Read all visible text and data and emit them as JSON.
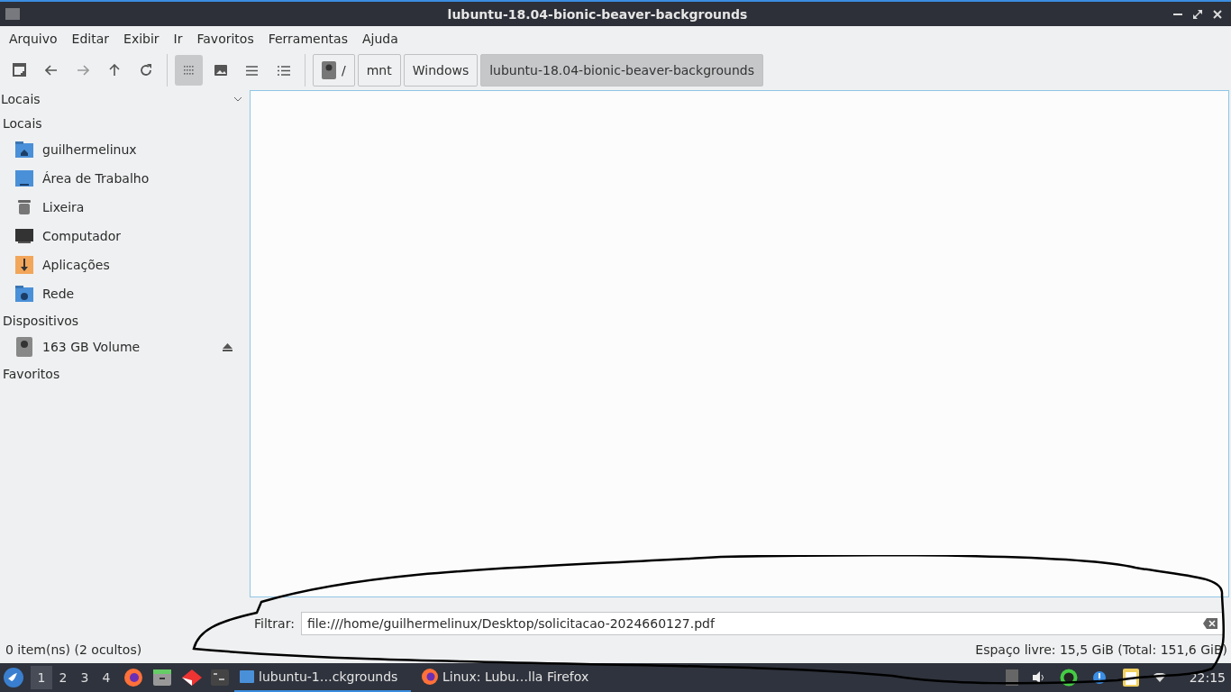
{
  "window": {
    "title": "lubuntu-18.04-bionic-beaver-backgrounds"
  },
  "menu": [
    "Arquivo",
    "Editar",
    "Exibir",
    "Ir",
    "Favoritos",
    "Ferramentas",
    "Ajuda"
  ],
  "toolbar": {
    "view_modes": [
      {
        "kind": "icons",
        "selected": true
      },
      {
        "kind": "thumbnails",
        "selected": false
      },
      {
        "kind": "compact",
        "selected": false
      },
      {
        "kind": "detailed",
        "selected": false
      }
    ]
  },
  "path": [
    {
      "label": "/",
      "kind": "drive",
      "selected": false
    },
    {
      "label": "mnt",
      "kind": "plain",
      "selected": false
    },
    {
      "label": "Windows",
      "kind": "plain",
      "selected": false
    },
    {
      "label": "lubuntu-18.04-bionic-beaver-backgrounds",
      "kind": "plain",
      "selected": true
    }
  ],
  "sidebar": {
    "header": "Locais",
    "sections": [
      {
        "title": "Locais",
        "items": [
          {
            "label": "guilhermelinux",
            "kind": "home"
          },
          {
            "label": "Área de Trabalho",
            "kind": "desktop"
          },
          {
            "label": "Lixeira",
            "kind": "trash"
          },
          {
            "label": "Computador",
            "kind": "computer"
          },
          {
            "label": "Aplicações",
            "kind": "apps"
          },
          {
            "label": "Rede",
            "kind": "network"
          }
        ]
      },
      {
        "title": "Dispositivos",
        "items": [
          {
            "label": "163 GB Volume",
            "kind": "drive"
          }
        ]
      },
      {
        "title": "Favoritos"
      }
    ]
  },
  "filter": {
    "label": "Filtrar:",
    "value": "file:///home/guilhermelinux/Desktop/solicitacao-2024660127.pdf"
  },
  "status_bar": {
    "items": "0 item(ns) (2 ocultos)",
    "space": "Espaço livre: 15,5 GiB (Total: 151,6 GiB)"
  },
  "taskbar": {
    "desktops": [
      {
        "label": "1",
        "selected": true
      },
      {
        "label": "2",
        "selected": false
      },
      {
        "label": "3",
        "selected": false
      },
      {
        "label": "4",
        "selected": false
      }
    ],
    "tasks": [
      {
        "label": "lubuntu-1…ckgrounds",
        "kind": "folder",
        "selected": true
      },
      {
        "label": "Linux: Lubu…lla Firefox",
        "kind": "firefox",
        "selected": false
      }
    ],
    "clock": "22:15"
  }
}
